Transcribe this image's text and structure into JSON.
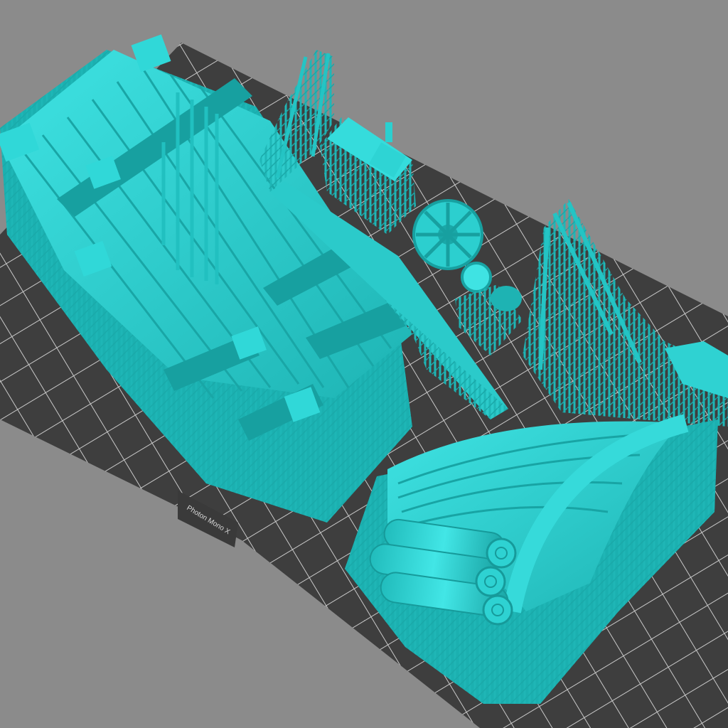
{
  "viewport": {
    "printer_name": "Photon Mono X"
  },
  "colors": {
    "background": "#8b8b8b",
    "plate": "#3d3d3d",
    "grid": "#c8c8c8",
    "model": "#25c9c9",
    "model_light": "#3fe3e3",
    "model_dark": "#149a9a",
    "support": "#1fb7b7"
  },
  "models": [
    {
      "name": "bridge-deck-left"
    },
    {
      "name": "ladder-frame"
    },
    {
      "name": "crate-small"
    },
    {
      "name": "wheel-and-pot"
    },
    {
      "name": "scaffold-right"
    },
    {
      "name": "log-roll-wagon"
    }
  ]
}
